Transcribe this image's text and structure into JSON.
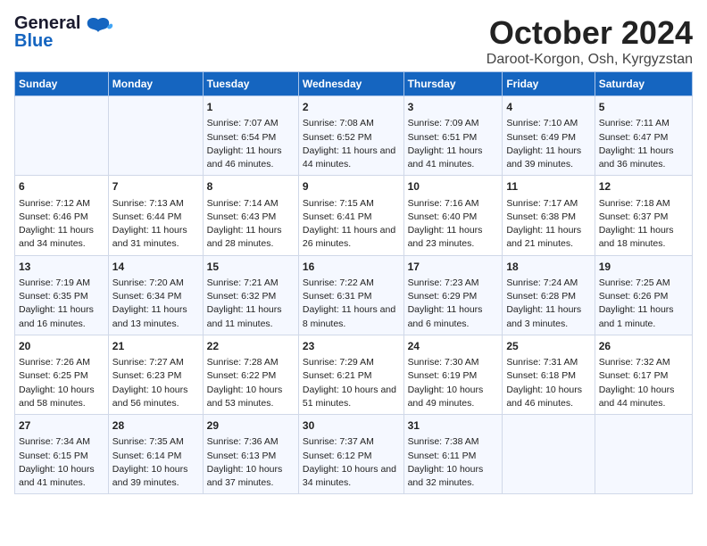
{
  "header": {
    "logo_general": "General",
    "logo_blue": "Blue",
    "month": "October 2024",
    "location": "Daroot-Korgon, Osh, Kyrgyzstan"
  },
  "days_of_week": [
    "Sunday",
    "Monday",
    "Tuesday",
    "Wednesday",
    "Thursday",
    "Friday",
    "Saturday"
  ],
  "weeks": [
    [
      {
        "day": "",
        "content": ""
      },
      {
        "day": "",
        "content": ""
      },
      {
        "day": "1",
        "content": "Sunrise: 7:07 AM\nSunset: 6:54 PM\nDaylight: 11 hours and 46 minutes."
      },
      {
        "day": "2",
        "content": "Sunrise: 7:08 AM\nSunset: 6:52 PM\nDaylight: 11 hours and 44 minutes."
      },
      {
        "day": "3",
        "content": "Sunrise: 7:09 AM\nSunset: 6:51 PM\nDaylight: 11 hours and 41 minutes."
      },
      {
        "day": "4",
        "content": "Sunrise: 7:10 AM\nSunset: 6:49 PM\nDaylight: 11 hours and 39 minutes."
      },
      {
        "day": "5",
        "content": "Sunrise: 7:11 AM\nSunset: 6:47 PM\nDaylight: 11 hours and 36 minutes."
      }
    ],
    [
      {
        "day": "6",
        "content": "Sunrise: 7:12 AM\nSunset: 6:46 PM\nDaylight: 11 hours and 34 minutes."
      },
      {
        "day": "7",
        "content": "Sunrise: 7:13 AM\nSunset: 6:44 PM\nDaylight: 11 hours and 31 minutes."
      },
      {
        "day": "8",
        "content": "Sunrise: 7:14 AM\nSunset: 6:43 PM\nDaylight: 11 hours and 28 minutes."
      },
      {
        "day": "9",
        "content": "Sunrise: 7:15 AM\nSunset: 6:41 PM\nDaylight: 11 hours and 26 minutes."
      },
      {
        "day": "10",
        "content": "Sunrise: 7:16 AM\nSunset: 6:40 PM\nDaylight: 11 hours and 23 minutes."
      },
      {
        "day": "11",
        "content": "Sunrise: 7:17 AM\nSunset: 6:38 PM\nDaylight: 11 hours and 21 minutes."
      },
      {
        "day": "12",
        "content": "Sunrise: 7:18 AM\nSunset: 6:37 PM\nDaylight: 11 hours and 18 minutes."
      }
    ],
    [
      {
        "day": "13",
        "content": "Sunrise: 7:19 AM\nSunset: 6:35 PM\nDaylight: 11 hours and 16 minutes."
      },
      {
        "day": "14",
        "content": "Sunrise: 7:20 AM\nSunset: 6:34 PM\nDaylight: 11 hours and 13 minutes."
      },
      {
        "day": "15",
        "content": "Sunrise: 7:21 AM\nSunset: 6:32 PM\nDaylight: 11 hours and 11 minutes."
      },
      {
        "day": "16",
        "content": "Sunrise: 7:22 AM\nSunset: 6:31 PM\nDaylight: 11 hours and 8 minutes."
      },
      {
        "day": "17",
        "content": "Sunrise: 7:23 AM\nSunset: 6:29 PM\nDaylight: 11 hours and 6 minutes."
      },
      {
        "day": "18",
        "content": "Sunrise: 7:24 AM\nSunset: 6:28 PM\nDaylight: 11 hours and 3 minutes."
      },
      {
        "day": "19",
        "content": "Sunrise: 7:25 AM\nSunset: 6:26 PM\nDaylight: 11 hours and 1 minute."
      }
    ],
    [
      {
        "day": "20",
        "content": "Sunrise: 7:26 AM\nSunset: 6:25 PM\nDaylight: 10 hours and 58 minutes."
      },
      {
        "day": "21",
        "content": "Sunrise: 7:27 AM\nSunset: 6:23 PM\nDaylight: 10 hours and 56 minutes."
      },
      {
        "day": "22",
        "content": "Sunrise: 7:28 AM\nSunset: 6:22 PM\nDaylight: 10 hours and 53 minutes."
      },
      {
        "day": "23",
        "content": "Sunrise: 7:29 AM\nSunset: 6:21 PM\nDaylight: 10 hours and 51 minutes."
      },
      {
        "day": "24",
        "content": "Sunrise: 7:30 AM\nSunset: 6:19 PM\nDaylight: 10 hours and 49 minutes."
      },
      {
        "day": "25",
        "content": "Sunrise: 7:31 AM\nSunset: 6:18 PM\nDaylight: 10 hours and 46 minutes."
      },
      {
        "day": "26",
        "content": "Sunrise: 7:32 AM\nSunset: 6:17 PM\nDaylight: 10 hours and 44 minutes."
      }
    ],
    [
      {
        "day": "27",
        "content": "Sunrise: 7:34 AM\nSunset: 6:15 PM\nDaylight: 10 hours and 41 minutes."
      },
      {
        "day": "28",
        "content": "Sunrise: 7:35 AM\nSunset: 6:14 PM\nDaylight: 10 hours and 39 minutes."
      },
      {
        "day": "29",
        "content": "Sunrise: 7:36 AM\nSunset: 6:13 PM\nDaylight: 10 hours and 37 minutes."
      },
      {
        "day": "30",
        "content": "Sunrise: 7:37 AM\nSunset: 6:12 PM\nDaylight: 10 hours and 34 minutes."
      },
      {
        "day": "31",
        "content": "Sunrise: 7:38 AM\nSunset: 6:11 PM\nDaylight: 10 hours and 32 minutes."
      },
      {
        "day": "",
        "content": ""
      },
      {
        "day": "",
        "content": ""
      }
    ]
  ]
}
